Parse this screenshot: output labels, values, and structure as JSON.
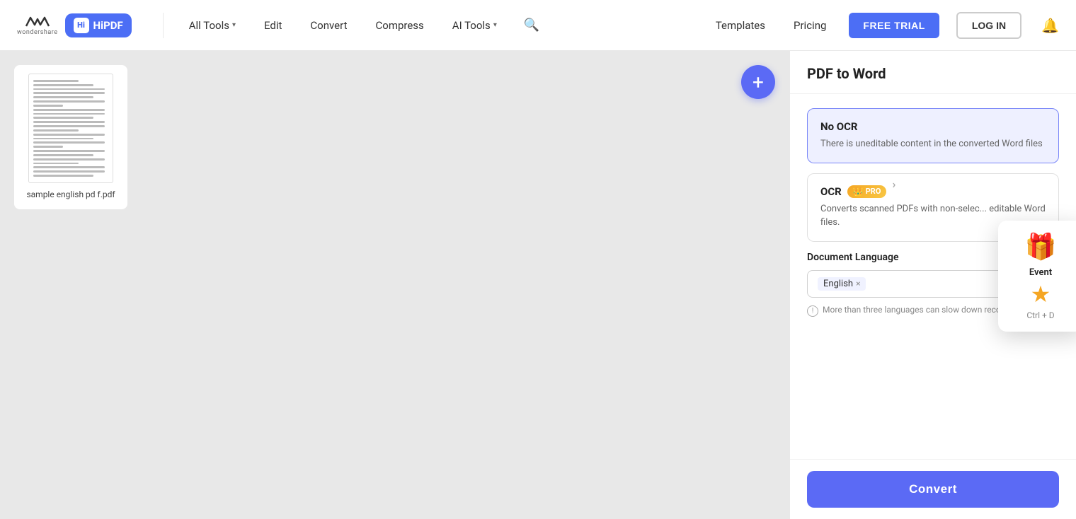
{
  "navbar": {
    "brand": "wondershare",
    "hipdf_label": "HiPDF",
    "all_tools": "All Tools",
    "edit": "Edit",
    "convert": "Convert",
    "compress": "Compress",
    "ai_tools": "AI Tools",
    "templates": "Templates",
    "pricing": "Pricing",
    "free_trial": "FREE TRIAL",
    "login": "LOG IN"
  },
  "panel": {
    "title": "PDF to Word",
    "no_ocr_title": "No OCR",
    "no_ocr_desc": "There is uneditable content in the converted Word files",
    "ocr_title": "OCR",
    "ocr_pro": "PRO",
    "ocr_desc": "Converts scanned PDFs with non-selec... editable Word files.",
    "doc_lang_label": "Document Language",
    "lang_selected": "English",
    "lang_warning": "More than three languages can slow down recognition.",
    "convert_btn": "Convert"
  },
  "file": {
    "name": "sample english pd f.pdf"
  },
  "tooltip": {
    "event_label": "Event",
    "shortcut": "Ctrl + D"
  }
}
